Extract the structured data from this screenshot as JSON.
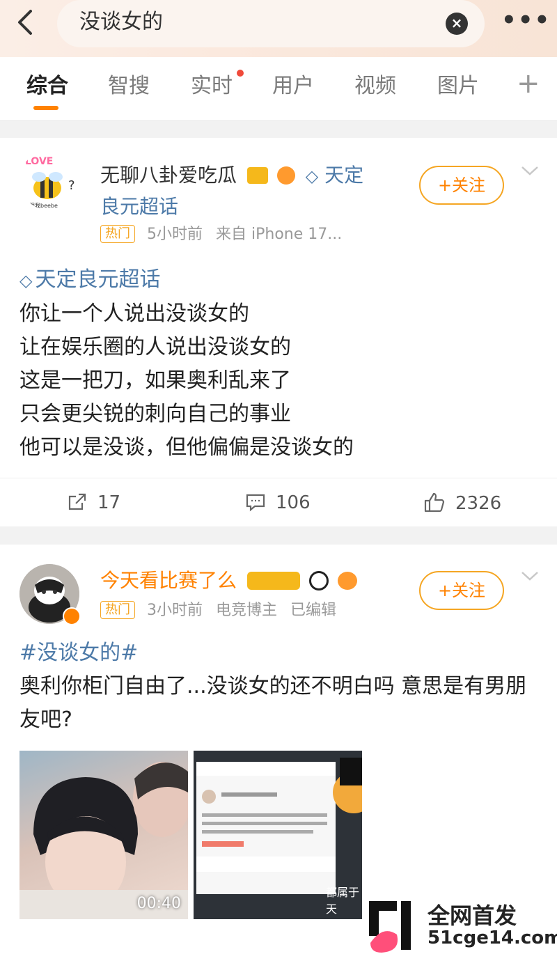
{
  "search": {
    "query": "没谈女的"
  },
  "tabs": [
    {
      "label": "综合"
    },
    {
      "label": "智搜"
    },
    {
      "label": "实时"
    },
    {
      "label": "用户"
    },
    {
      "label": "视频"
    },
    {
      "label": "图片"
    }
  ],
  "posts": [
    {
      "author": "无聊八卦爱吃瓜",
      "author_suffix": "天定良元超话",
      "hot_badge": "热门",
      "time": "5小时前",
      "source": "来自 iPhone 17...",
      "follow_label": "+关注",
      "topic": "天定良元超话",
      "lines": [
        "你让一个人说出没谈女的",
        "让在娱乐圈的人说出没谈女的",
        "这是一把刀，如果奥利乱来了",
        "只会更尖锐的刺向自己的事业",
        "他可以是没谈，但他偏偏是没谈女的"
      ],
      "reposts": "17",
      "comments": "106",
      "likes": "2326",
      "avatar_text": "LOVE",
      "avatar_caption": "在跟我beebe"
    },
    {
      "author": "今天看比赛了么",
      "hot_badge": "热门",
      "time": "3小时前",
      "source": "电竞博主",
      "edited": "已编辑",
      "follow_label": "+关注",
      "topic": "#没谈女的#",
      "text": "奥利你柜门自由了...没谈女的还不明白吗 意思是有男朋友吧?",
      "video_duration": "00:40",
      "image2_caption": "都属于天"
    }
  ],
  "watermark": {
    "line1": "全网首发",
    "line2": "51cge14.com"
  },
  "colors": {
    "accent": "#ff8200",
    "link": "#4d7aa8",
    "hot": "#f5a623"
  }
}
